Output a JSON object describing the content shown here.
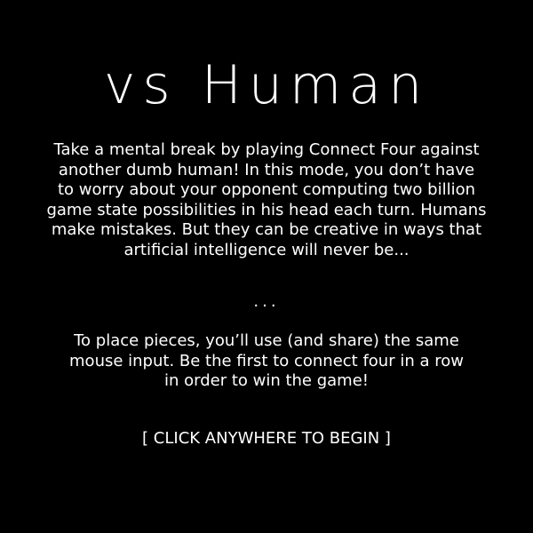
{
  "screen": {
    "title": "vs Human",
    "intro_text": "Take a mental break by playing Connect Four against\nanother dumb human! In this mode, you don’t have\nto worry about your opponent computing two billion\ngame state possibilities in his head each turn. Humans\nmake mistakes. But they can be creative in ways that\nartificial intelligence will never be...",
    "separator": "...",
    "instructions_text": "To place pieces, you’ll use (and share) the same\nmouse input. Be the first to connect four in a row\nin order to win the game!",
    "begin_prompt": "[ CLICK ANYWHERE TO BEGIN ]"
  },
  "colors": {
    "background": "#000000",
    "text": "#ffffff"
  }
}
